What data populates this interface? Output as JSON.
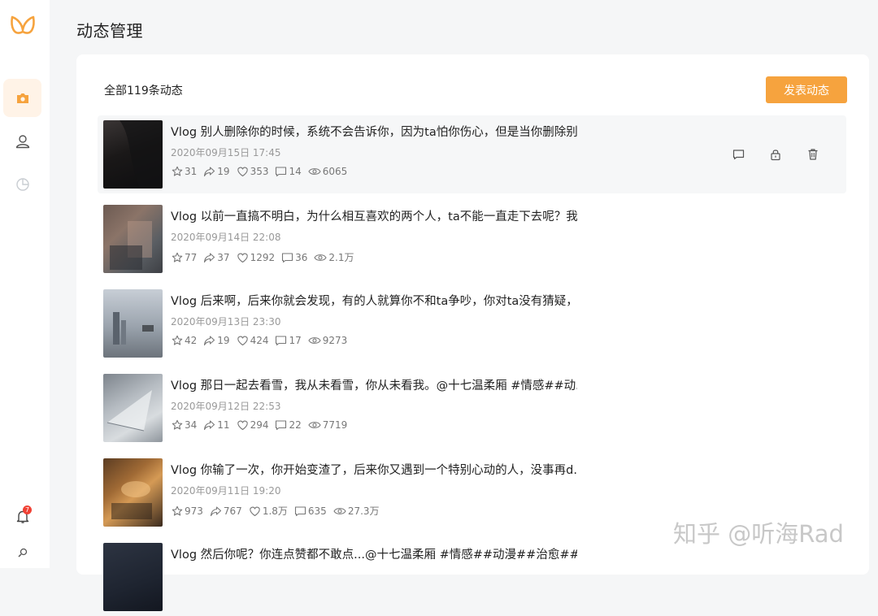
{
  "page": {
    "title": "动态管理"
  },
  "sidebar": {
    "items": [
      {
        "name": "camera",
        "active": true
      },
      {
        "name": "user",
        "active": false
      },
      {
        "name": "chart",
        "active": false
      }
    ],
    "notification_count": "7"
  },
  "main": {
    "count_label": "全部119条动态",
    "publish_button": "发表动态",
    "posts": [
      {
        "title": "Vlog 别人删除你的时候，系统不会告诉你，因为ta怕你伤心，但是当你删除别...",
        "date": "2020年09月15日 17:45",
        "favorites": "31",
        "shares": "19",
        "likes": "353",
        "comments": "14",
        "views": "6065"
      },
      {
        "title": "Vlog 以前一直搞不明白，为什么相互喜欢的两个人，ta不能一直走下去呢？我...",
        "date": "2020年09月14日 22:08",
        "favorites": "77",
        "shares": "37",
        "likes": "1292",
        "comments": "36",
        "views": "2.1万"
      },
      {
        "title": "Vlog 后来啊，后来你就会发现，有的人就算你不和ta争吵，你对ta没有猜疑，...",
        "date": "2020年09月13日 23:30",
        "favorites": "42",
        "shares": "19",
        "likes": "424",
        "comments": "17",
        "views": "9273"
      },
      {
        "title": "Vlog 那日一起去看雪，我从未看雪，你从未看我。@十七温柔厢  #情感##动...",
        "date": "2020年09月12日 22:53",
        "favorites": "34",
        "shares": "11",
        "likes": "294",
        "comments": "22",
        "views": "7719"
      },
      {
        "title": "Vlog 你输了一次，你开始变渣了，后来你又遇到一个特别心动的人，没事再d...",
        "date": "2020年09月11日 19:20",
        "favorites": "973",
        "shares": "767",
        "likes": "1.8万",
        "comments": "635",
        "views": "27.3万"
      },
      {
        "title": "Vlog 然后你呢？你连点赞都不敢点...@十七温柔厢  #情感##动漫##治愈##文...",
        "date": "",
        "favorites": "",
        "shares": "",
        "likes": "",
        "comments": "",
        "views": ""
      }
    ]
  },
  "watermark": "知乎 @听海Rad",
  "colors": {
    "accent": "#f6a33e",
    "active_bg": "#fff3e7",
    "badge": "#f04134"
  }
}
